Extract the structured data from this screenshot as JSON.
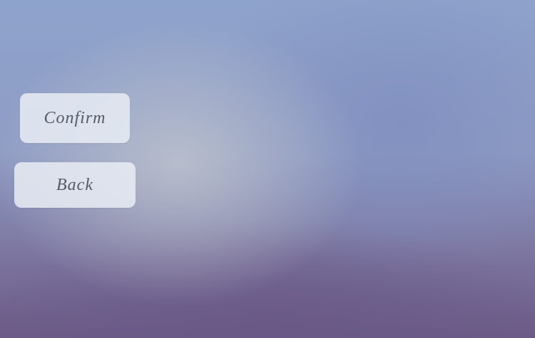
{
  "buttons": {
    "confirm_label": "Confirm",
    "back_label": "Back"
  }
}
